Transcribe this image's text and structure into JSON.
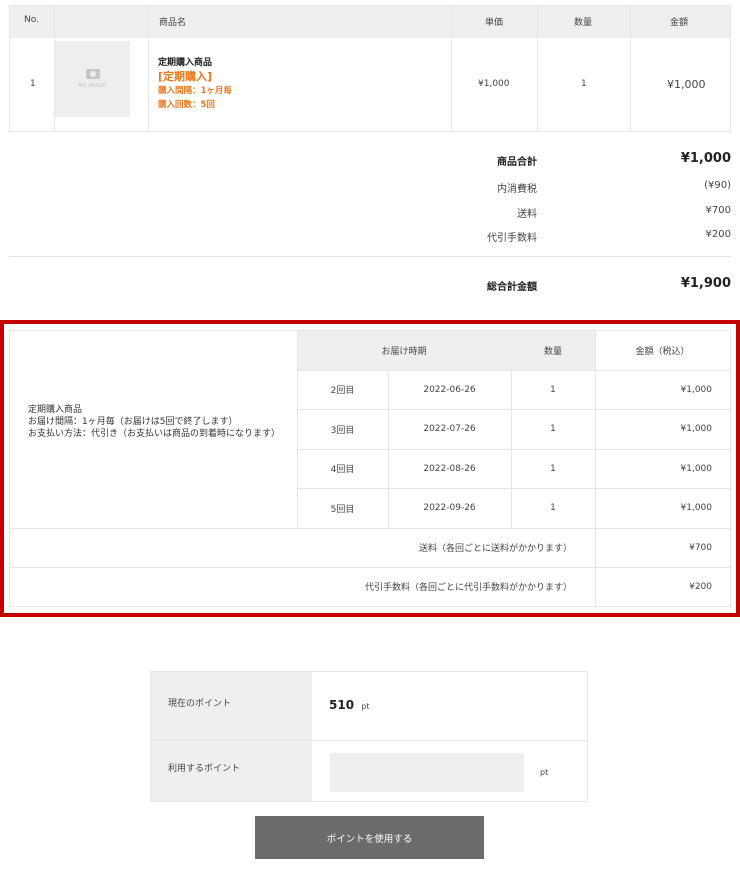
{
  "cart": {
    "headers": {
      "no": "No.",
      "name": "商品名",
      "unit": "単価",
      "qty": "数量",
      "amount": "金額"
    },
    "item": {
      "no": "1",
      "image_text": "NO IMAGE",
      "name": "定期購入商品",
      "tag": "[定期購入]",
      "interval": "購入間隔：1ヶ月毎",
      "count": "購入回数：5回",
      "unit_price": "¥1,000",
      "qty": "1",
      "amount": "¥1,000"
    }
  },
  "totals": {
    "subtotal_label": "商品合計",
    "subtotal": "¥1,000",
    "tax_label": "内消費税",
    "tax": "(¥90)",
    "shipping_label": "送料",
    "shipping": "¥700",
    "cod_label": "代引手数料",
    "cod": "¥200",
    "grand_label": "総合計金額",
    "grand": "¥1,900"
  },
  "schedule": {
    "headers": {
      "delivery": "お届け時期",
      "qty": "数量",
      "amount": "金額（税込）"
    },
    "desc": {
      "line1": "定期購入商品",
      "line2": "お届け間隔：1ヶ月毎（お届けは5回で終了します）",
      "line3": "お支払い方法：代引き（お支払いは商品の到着時になります）"
    },
    "rows": [
      {
        "round": "2回目",
        "date": "2022-06-26",
        "qty": "1",
        "amount": "¥1,000"
      },
      {
        "round": "3回目",
        "date": "2022-07-26",
        "qty": "1",
        "amount": "¥1,000"
      },
      {
        "round": "4回目",
        "date": "2022-08-26",
        "qty": "1",
        "amount": "¥1,000"
      },
      {
        "round": "5回目",
        "date": "2022-09-26",
        "qty": "1",
        "amount": "¥1,000"
      }
    ],
    "shipping_label": "送料（各回ごとに送料がかかります）",
    "shipping_value": "¥700",
    "cod_label": "代引手数料（各回ごとに代引手数料がかかります）",
    "cod_value": "¥200"
  },
  "points": {
    "current_label": "現在のポイント",
    "current_value": "510",
    "unit": "pt",
    "use_label": "利用するポイント",
    "use_value": "",
    "use_unit": "pt",
    "button_label": "ポイントを使用する"
  },
  "colors": {
    "accent_orange": "#e67a1e",
    "highlight_red": "#c40000",
    "button_gray": "#6b6b6b"
  }
}
